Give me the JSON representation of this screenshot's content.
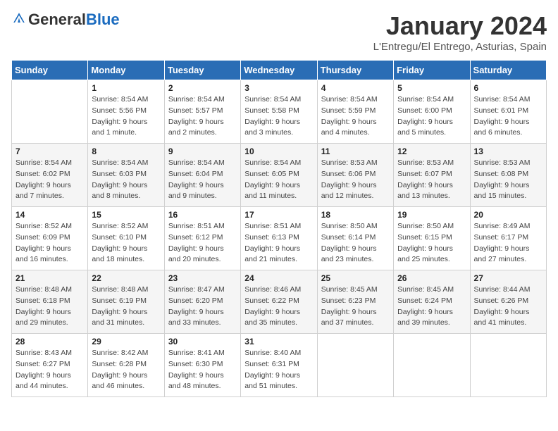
{
  "logo": {
    "general": "General",
    "blue": "Blue"
  },
  "header": {
    "title": "January 2024",
    "subtitle": "L'Entregu/El Entrego, Asturias, Spain"
  },
  "days_of_week": [
    "Sunday",
    "Monday",
    "Tuesday",
    "Wednesday",
    "Thursday",
    "Friday",
    "Saturday"
  ],
  "weeks": [
    [
      {
        "day": "",
        "info": ""
      },
      {
        "day": "1",
        "info": "Sunrise: 8:54 AM\nSunset: 5:56 PM\nDaylight: 9 hours\nand 1 minute."
      },
      {
        "day": "2",
        "info": "Sunrise: 8:54 AM\nSunset: 5:57 PM\nDaylight: 9 hours\nand 2 minutes."
      },
      {
        "day": "3",
        "info": "Sunrise: 8:54 AM\nSunset: 5:58 PM\nDaylight: 9 hours\nand 3 minutes."
      },
      {
        "day": "4",
        "info": "Sunrise: 8:54 AM\nSunset: 5:59 PM\nDaylight: 9 hours\nand 4 minutes."
      },
      {
        "day": "5",
        "info": "Sunrise: 8:54 AM\nSunset: 6:00 PM\nDaylight: 9 hours\nand 5 minutes."
      },
      {
        "day": "6",
        "info": "Sunrise: 8:54 AM\nSunset: 6:01 PM\nDaylight: 9 hours\nand 6 minutes."
      }
    ],
    [
      {
        "day": "7",
        "info": "Sunrise: 8:54 AM\nSunset: 6:02 PM\nDaylight: 9 hours\nand 7 minutes."
      },
      {
        "day": "8",
        "info": "Sunrise: 8:54 AM\nSunset: 6:03 PM\nDaylight: 9 hours\nand 8 minutes."
      },
      {
        "day": "9",
        "info": "Sunrise: 8:54 AM\nSunset: 6:04 PM\nDaylight: 9 hours\nand 9 minutes."
      },
      {
        "day": "10",
        "info": "Sunrise: 8:54 AM\nSunset: 6:05 PM\nDaylight: 9 hours\nand 11 minutes."
      },
      {
        "day": "11",
        "info": "Sunrise: 8:53 AM\nSunset: 6:06 PM\nDaylight: 9 hours\nand 12 minutes."
      },
      {
        "day": "12",
        "info": "Sunrise: 8:53 AM\nSunset: 6:07 PM\nDaylight: 9 hours\nand 13 minutes."
      },
      {
        "day": "13",
        "info": "Sunrise: 8:53 AM\nSunset: 6:08 PM\nDaylight: 9 hours\nand 15 minutes."
      }
    ],
    [
      {
        "day": "14",
        "info": "Sunrise: 8:52 AM\nSunset: 6:09 PM\nDaylight: 9 hours\nand 16 minutes."
      },
      {
        "day": "15",
        "info": "Sunrise: 8:52 AM\nSunset: 6:10 PM\nDaylight: 9 hours\nand 18 minutes."
      },
      {
        "day": "16",
        "info": "Sunrise: 8:51 AM\nSunset: 6:12 PM\nDaylight: 9 hours\nand 20 minutes."
      },
      {
        "day": "17",
        "info": "Sunrise: 8:51 AM\nSunset: 6:13 PM\nDaylight: 9 hours\nand 21 minutes."
      },
      {
        "day": "18",
        "info": "Sunrise: 8:50 AM\nSunset: 6:14 PM\nDaylight: 9 hours\nand 23 minutes."
      },
      {
        "day": "19",
        "info": "Sunrise: 8:50 AM\nSunset: 6:15 PM\nDaylight: 9 hours\nand 25 minutes."
      },
      {
        "day": "20",
        "info": "Sunrise: 8:49 AM\nSunset: 6:17 PM\nDaylight: 9 hours\nand 27 minutes."
      }
    ],
    [
      {
        "day": "21",
        "info": "Sunrise: 8:48 AM\nSunset: 6:18 PM\nDaylight: 9 hours\nand 29 minutes."
      },
      {
        "day": "22",
        "info": "Sunrise: 8:48 AM\nSunset: 6:19 PM\nDaylight: 9 hours\nand 31 minutes."
      },
      {
        "day": "23",
        "info": "Sunrise: 8:47 AM\nSunset: 6:20 PM\nDaylight: 9 hours\nand 33 minutes."
      },
      {
        "day": "24",
        "info": "Sunrise: 8:46 AM\nSunset: 6:22 PM\nDaylight: 9 hours\nand 35 minutes."
      },
      {
        "day": "25",
        "info": "Sunrise: 8:45 AM\nSunset: 6:23 PM\nDaylight: 9 hours\nand 37 minutes."
      },
      {
        "day": "26",
        "info": "Sunrise: 8:45 AM\nSunset: 6:24 PM\nDaylight: 9 hours\nand 39 minutes."
      },
      {
        "day": "27",
        "info": "Sunrise: 8:44 AM\nSunset: 6:26 PM\nDaylight: 9 hours\nand 41 minutes."
      }
    ],
    [
      {
        "day": "28",
        "info": "Sunrise: 8:43 AM\nSunset: 6:27 PM\nDaylight: 9 hours\nand 44 minutes."
      },
      {
        "day": "29",
        "info": "Sunrise: 8:42 AM\nSunset: 6:28 PM\nDaylight: 9 hours\nand 46 minutes."
      },
      {
        "day": "30",
        "info": "Sunrise: 8:41 AM\nSunset: 6:30 PM\nDaylight: 9 hours\nand 48 minutes."
      },
      {
        "day": "31",
        "info": "Sunrise: 8:40 AM\nSunset: 6:31 PM\nDaylight: 9 hours\nand 51 minutes."
      },
      {
        "day": "",
        "info": ""
      },
      {
        "day": "",
        "info": ""
      },
      {
        "day": "",
        "info": ""
      }
    ]
  ]
}
